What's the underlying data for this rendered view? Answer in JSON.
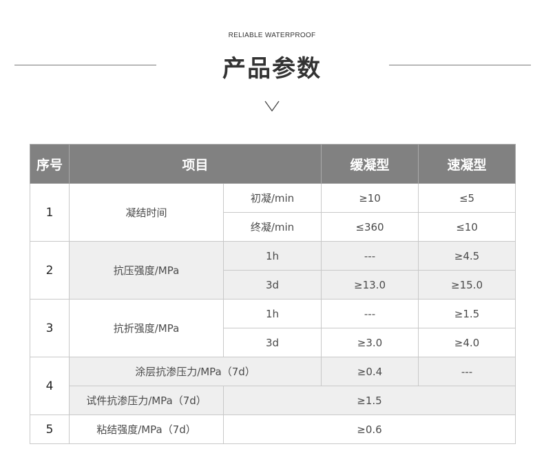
{
  "header": {
    "subtitle": "RELIABLE WATERPROOF",
    "title": "产品参数"
  },
  "table": {
    "columns": [
      "序号",
      "项目",
      "缓凝型",
      "速凝型"
    ],
    "rows": [
      {
        "no": "1",
        "item": "凝结时间",
        "sub": "初凝/min",
        "slow": "≥10",
        "fast": "≤5"
      },
      {
        "sub": "终凝/min",
        "slow": "≤360",
        "fast": "≤10"
      },
      {
        "no": "2",
        "item": "抗压强度/MPa",
        "sub": "1h",
        "slow": "---",
        "fast": "≥4.5"
      },
      {
        "sub": "3d",
        "slow": "≥13.0",
        "fast": "≥15.0"
      },
      {
        "no": "3",
        "item": "抗折强度/MPa",
        "sub": "1h",
        "slow": "---",
        "fast": "≥1.5"
      },
      {
        "sub": "3d",
        "slow": "≥3.0",
        "fast": "≥4.0"
      },
      {
        "no": "4",
        "item": "涂层抗渗压力/MPa（7d）",
        "slow": "≥0.4",
        "fast": "---"
      },
      {
        "item": "试件抗渗压力/MPa（7d）",
        "value": "≥1.5"
      },
      {
        "no": "5",
        "item": "粘结强度/MPa（7d）",
        "value": "≥0.6"
      }
    ]
  }
}
